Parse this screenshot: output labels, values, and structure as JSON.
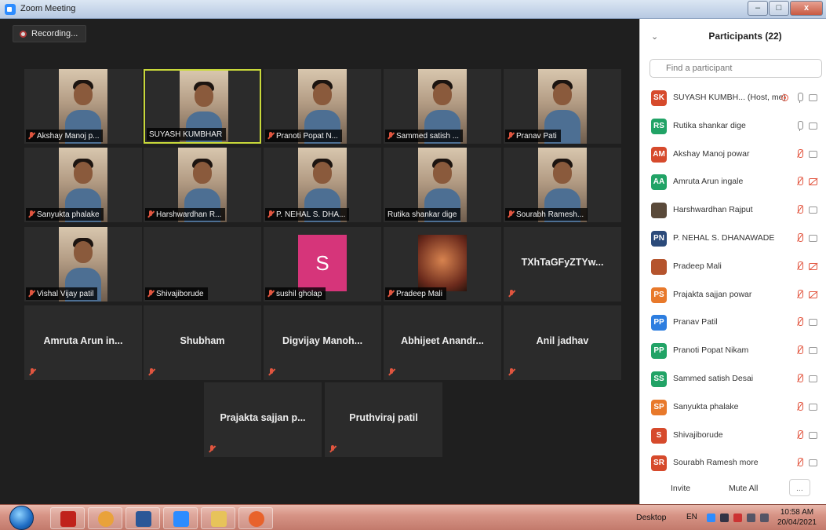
{
  "window": {
    "title": "Zoom Meeting",
    "buttons": [
      "–",
      "□",
      "x"
    ]
  },
  "recording": {
    "label": "Recording..."
  },
  "video_tiles": [
    {
      "name": "Akshay Manoj p...",
      "type": "video",
      "muted": true,
      "active": false
    },
    {
      "name": "SUYASH KUMBHAR",
      "type": "video",
      "muted": false,
      "active": true
    },
    {
      "name": "Pranoti Popat N...",
      "type": "video",
      "muted": true,
      "active": false
    },
    {
      "name": "Sammed satish ...",
      "type": "video",
      "muted": true,
      "active": false
    },
    {
      "name": "Pranav Pati",
      "type": "video",
      "muted": true,
      "active": false
    },
    {
      "name": "Sanyukta phalake",
      "type": "video",
      "muted": true,
      "active": false
    },
    {
      "name": "Harshwardhan R...",
      "type": "video",
      "muted": true,
      "active": false
    },
    {
      "name": "P. NEHAL S. DHA...",
      "type": "video",
      "muted": true,
      "active": false
    },
    {
      "name": "Rutika shankar dige",
      "type": "video",
      "muted": false,
      "active": false
    },
    {
      "name": "Sourabh Ramesh...",
      "type": "video",
      "muted": true,
      "active": false
    },
    {
      "name": "Vishal Vijay patil",
      "type": "video",
      "muted": true,
      "active": false
    },
    {
      "name": "Shivajiborude",
      "type": "empty",
      "muted": true,
      "active": false
    },
    {
      "name": "sushil gholap",
      "type": "letter",
      "letter": "S",
      "muted": true,
      "active": false
    },
    {
      "name": "Pradeep Mali",
      "type": "picture",
      "muted": true,
      "active": false
    },
    {
      "name": "TXhTaGFyZTYw...",
      "type": "text",
      "muted": true,
      "active": false
    },
    {
      "name": "Amruta Arun in...",
      "type": "text",
      "muted": true,
      "active": false
    },
    {
      "name": "Shubham",
      "type": "text",
      "muted": true,
      "active": false
    },
    {
      "name": "Digvijay Manoh...",
      "type": "text",
      "muted": true,
      "active": false
    },
    {
      "name": "Abhijeet Anandr...",
      "type": "text",
      "muted": true,
      "active": false
    },
    {
      "name": "Anil jadhav",
      "type": "text",
      "muted": true,
      "active": false
    },
    {
      "name": "Prajakta sajjan p...",
      "type": "text",
      "muted": true,
      "active": false
    },
    {
      "name": "Pruthviraj patil",
      "type": "text",
      "muted": true,
      "active": false
    }
  ],
  "participants_panel": {
    "title": "Participants (22)",
    "search_placeholder": "Find a participant",
    "participants": [
      {
        "initials": "SK",
        "name": "SUYASH KUMBH... (Host, me)",
        "color": "#d64a2c",
        "mic": "on",
        "cam": "on",
        "recording": true
      },
      {
        "initials": "RS",
        "name": "Rutika shankar dige",
        "color": "#21a366",
        "mic": "on",
        "cam": "on"
      },
      {
        "initials": "AM",
        "name": "Akshay Manoj powar",
        "color": "#d64a2c",
        "mic": "off",
        "cam": "on"
      },
      {
        "initials": "AA",
        "name": "Amruta Arun ingale",
        "color": "#21a366",
        "mic": "off",
        "cam": "off"
      },
      {
        "initials": "",
        "name": "Harshwardhan Rajput",
        "color": "#5a4a3a",
        "mic": "off",
        "cam": "on",
        "photo": true
      },
      {
        "initials": "PN",
        "name": "P. NEHAL S. DHANAWADE",
        "color": "#2b4a7a",
        "mic": "off",
        "cam": "on"
      },
      {
        "initials": "",
        "name": "Pradeep Mali",
        "color": "#b5542d",
        "mic": "off",
        "cam": "off",
        "photo": true
      },
      {
        "initials": "PS",
        "name": "Prajakta sajjan powar",
        "color": "#e8792b",
        "mic": "off",
        "cam": "off"
      },
      {
        "initials": "PP",
        "name": "Pranav Patil",
        "color": "#2d7ee0",
        "mic": "off",
        "cam": "on"
      },
      {
        "initials": "PP",
        "name": "Pranoti Popat Nikam",
        "color": "#21a366",
        "mic": "off",
        "cam": "on"
      },
      {
        "initials": "SS",
        "name": "Sammed satish Desai",
        "color": "#21a366",
        "mic": "off",
        "cam": "on"
      },
      {
        "initials": "SP",
        "name": "Sanyukta phalake",
        "color": "#e8792b",
        "mic": "off",
        "cam": "on"
      },
      {
        "initials": "S",
        "name": "Shivajiborude",
        "color": "#d64a2c",
        "mic": "off",
        "cam": "on"
      },
      {
        "initials": "SR",
        "name": "Sourabh Ramesh more",
        "color": "#d64a2c",
        "mic": "off",
        "cam": "on"
      }
    ],
    "invite_label": "Invite",
    "mute_all_label": "Mute All",
    "more_label": "..."
  },
  "taskbar": {
    "desktop_label": "Desktop",
    "language": "EN",
    "time": "10:58 AM",
    "date": "20/04/2021",
    "apps": [
      "acrobat-icon",
      "chrome-icon",
      "word-icon",
      "zoom-icon",
      "file-manager-icon",
      "firefox-icon"
    ],
    "app_colors": [
      "#c0221b",
      "#e9a23b",
      "#2b5797",
      "#2d8cff",
      "#e7c35a",
      "#e8622b"
    ]
  }
}
